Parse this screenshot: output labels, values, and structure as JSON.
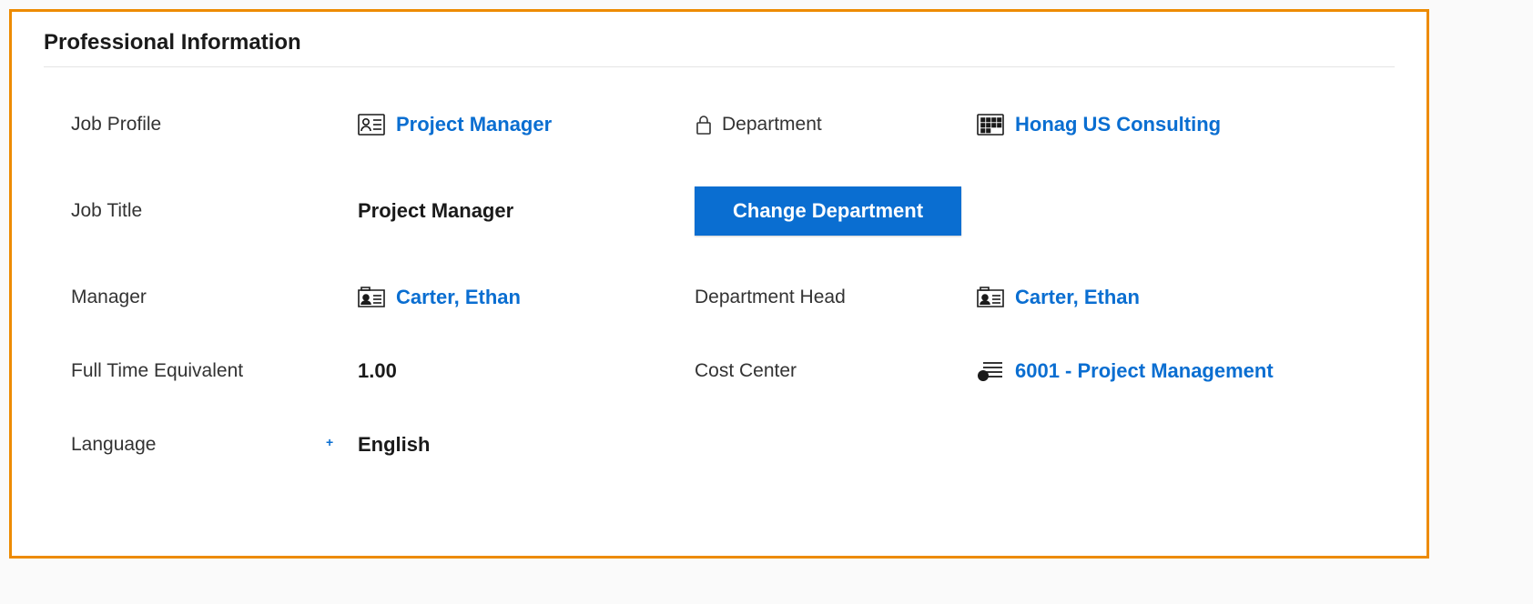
{
  "section": {
    "title": "Professional Information"
  },
  "fields": {
    "jobProfile": {
      "label": "Job Profile",
      "value": "Project Manager"
    },
    "department": {
      "label": "Department",
      "value": "Honag US Consulting"
    },
    "jobTitle": {
      "label": "Job Title",
      "value": "Project Manager"
    },
    "changeDepartmentBtn": "Change Department",
    "manager": {
      "label": "Manager",
      "value": "Carter, Ethan"
    },
    "departmentHead": {
      "label": "Department Head",
      "value": "Carter, Ethan"
    },
    "fte": {
      "label": "Full Time Equivalent",
      "value": "1.00"
    },
    "costCenter": {
      "label": "Cost Center",
      "value": "6001 - Project Management"
    },
    "language": {
      "label": "Language",
      "value": "English"
    }
  }
}
